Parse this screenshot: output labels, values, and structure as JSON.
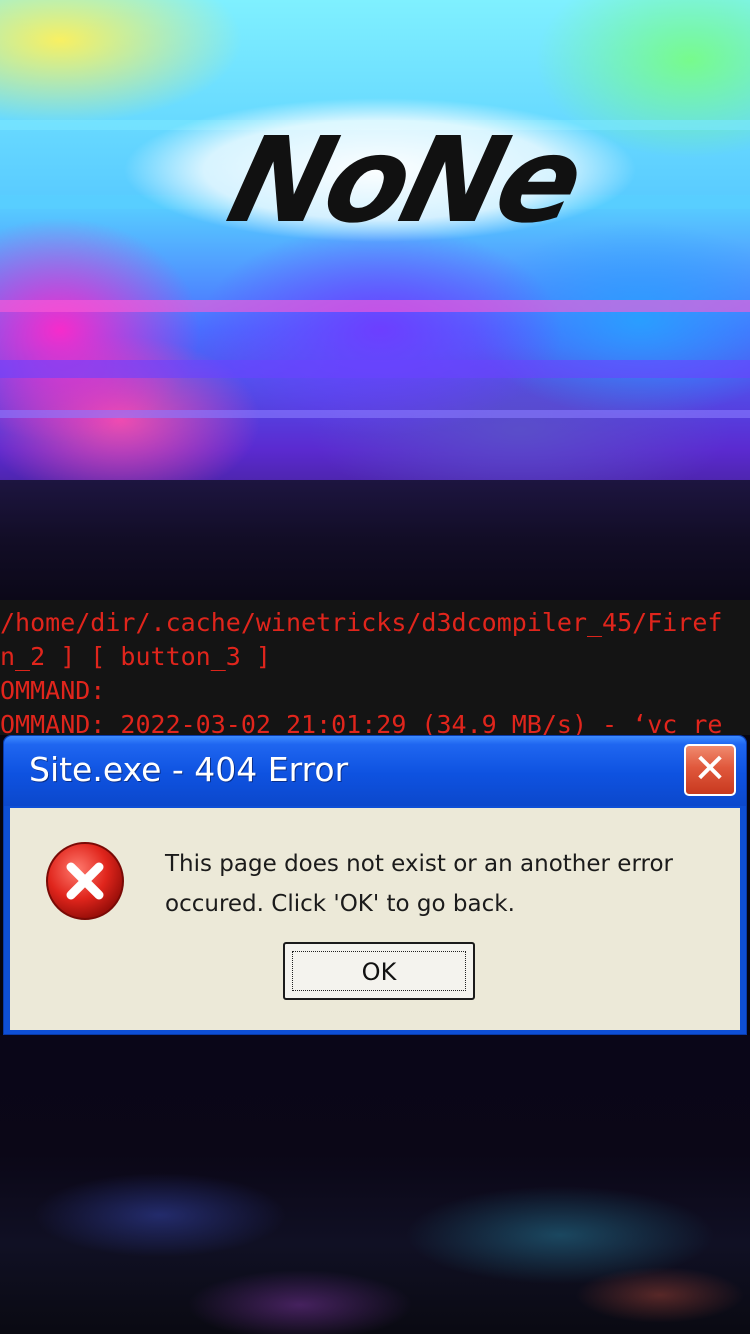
{
  "logo": {
    "text": "NoNe"
  },
  "terminal": {
    "lines": [
      "/home/dir/.cache/winetricks/d3dcompiler_45/Firef",
      "n_2 ] [ button_3 ]",
      "OMMAND:",
      "OMMAND: 2022-03-02 21:01:29 (34.9 MB/s) - ‘vc re"
    ],
    "text_color": "#e0251c"
  },
  "dialog": {
    "title": "Site.exe - 404 Error",
    "close_label": "✕",
    "message_line1": "This page does not exist or an another error",
    "message_line2": "occured. Click 'OK' to go back.",
    "ok_label": "OK",
    "icon": "error-x-icon",
    "colors": {
      "titlebar": "#0e52e0",
      "client": "#ece9d8",
      "close": "#e0583c"
    }
  }
}
